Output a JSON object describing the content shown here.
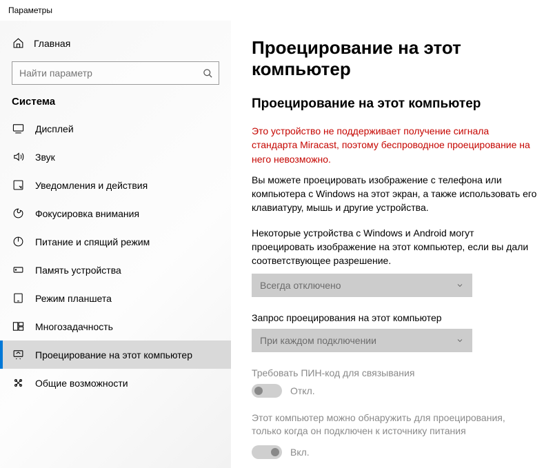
{
  "window_title": "Параметры",
  "home_label": "Главная",
  "search_placeholder": "Найти параметр",
  "section_label": "Система",
  "nav": [
    {
      "label": "Дисплей"
    },
    {
      "label": "Звук"
    },
    {
      "label": "Уведомления и действия"
    },
    {
      "label": "Фокусировка внимания"
    },
    {
      "label": "Питание и спящий режим"
    },
    {
      "label": "Память устройства"
    },
    {
      "label": "Режим планшета"
    },
    {
      "label": "Многозадачность"
    },
    {
      "label": "Проецирование на этот компьютер"
    },
    {
      "label": "Общие возможности"
    }
  ],
  "page": {
    "title": "Проецирование на этот компьютер",
    "subtitle": "Проецирование на этот компьютер",
    "error": "Это устройство не поддерживает получение сигнала стандарта Miracast, поэтому беспроводное проецирование на него невозможно.",
    "desc1": "Вы можете проецировать изображение с телефона или компьютера с Windows на этот экран, а также использовать его клавиатуру, мышь и другие устройства.",
    "desc2": "Некоторые устройства с Windows и Android могут проецировать изображение на этот компьютер, если вы дали соответствующее разрешение.",
    "dropdown1_value": "Всегда отключено",
    "field2_label": "Запрос проецирования на этот компьютер",
    "dropdown2_value": "При каждом подключении",
    "field3_label": "Требовать ПИН-код для связывания",
    "toggle1_label": "Откл.",
    "field4_label": "Этот компьютер можно обнаружить для проецирования, только когда он подключен к источнику питания",
    "toggle2_label": "Вкл."
  }
}
